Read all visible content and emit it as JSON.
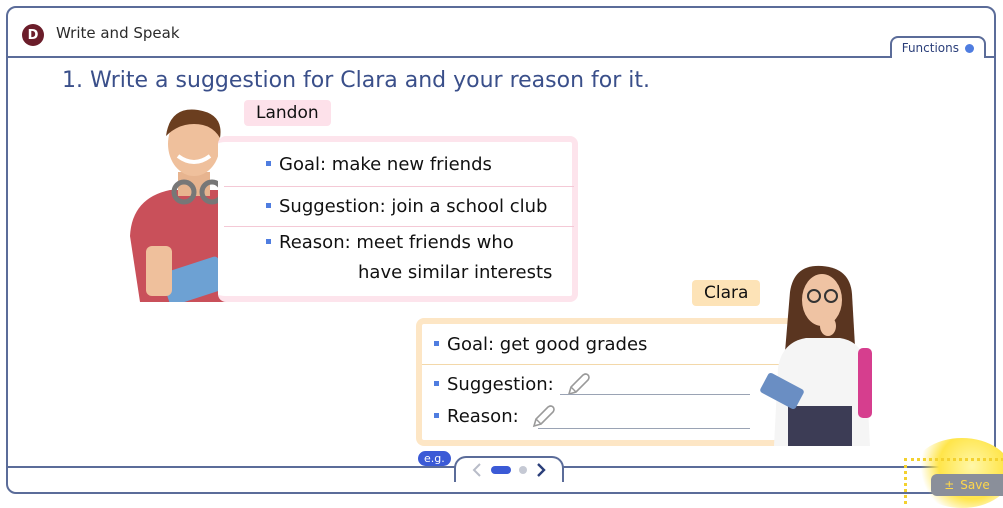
{
  "header": {
    "badge": "D",
    "title": "Write and Speak",
    "functions_label": "Functions"
  },
  "instruction": "1. Write a suggestion for Clara and your reason for it.",
  "landon": {
    "name": "Landon",
    "goal": "Goal: make new friends",
    "suggestion": "Suggestion: join a school club",
    "reason_line1": "Reason: meet friends who",
    "reason_line2": "have similar interests"
  },
  "clara": {
    "name": "Clara",
    "goal": "Goal: get good grades",
    "suggestion_label": "Suggestion:",
    "reason_label": "Reason:"
  },
  "footer": {
    "eg_label": "e.g.",
    "save_label": "Save",
    "page_current": 1,
    "page_total": 2
  },
  "colors": {
    "accent": "#5b6c99",
    "title": "#3a4f8a",
    "bullet": "#4f7de0",
    "landon_tag": "#fde1ea",
    "clara_tag": "#fde3b7"
  }
}
